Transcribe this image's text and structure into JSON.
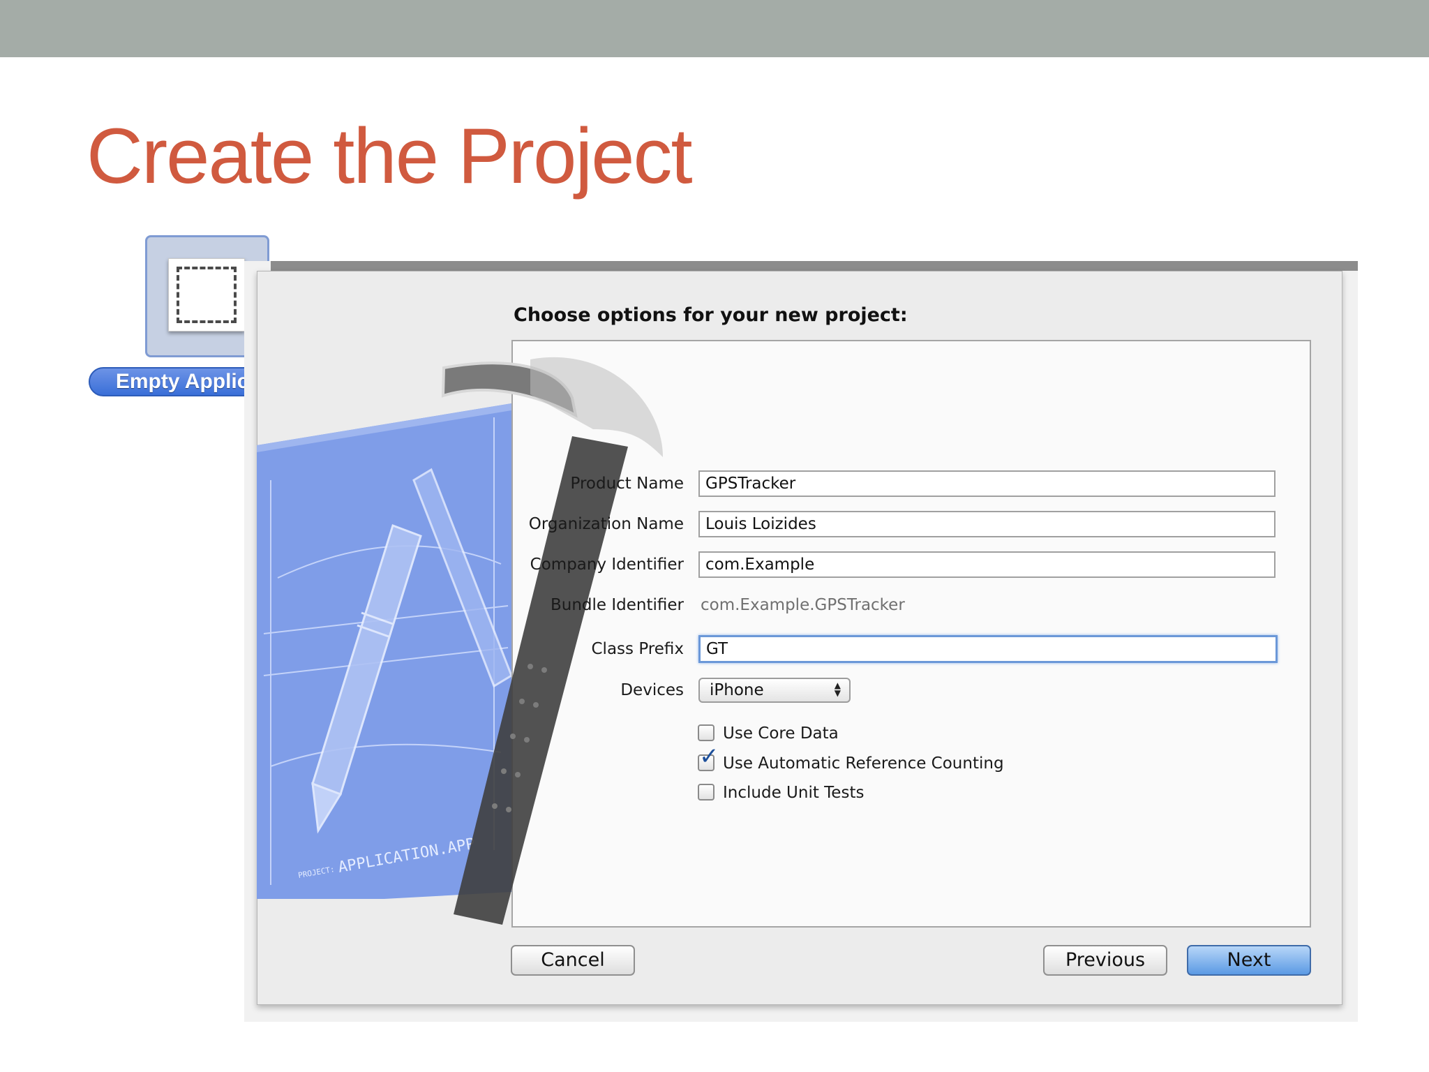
{
  "slide": {
    "title": "Create the Project"
  },
  "template": {
    "label": "Empty Application",
    "icon": "empty-window-icon"
  },
  "dialog": {
    "heading": "Choose options for your new project:",
    "fields": [
      {
        "label": "Product Name",
        "value": "GPSTracker"
      },
      {
        "label": "Organization Name",
        "value": "Louis Loizides"
      },
      {
        "label": "Company Identifier",
        "value": "com.Example"
      }
    ],
    "bundle": {
      "label": "Bundle Identifier",
      "value": "com.Example.GPSTracker"
    },
    "class_prefix": {
      "label": "Class Prefix",
      "value": "GT"
    },
    "devices": {
      "label": "Devices",
      "selected": "iPhone"
    },
    "checkboxes": [
      {
        "label": "Use Core Data",
        "checked": false
      },
      {
        "label": "Use Automatic Reference Counting",
        "checked": true
      },
      {
        "label": "Include Unit Tests",
        "checked": false
      }
    ],
    "buttons": {
      "cancel": "Cancel",
      "previous": "Previous",
      "next": "Next"
    },
    "artwork": {
      "blueprint_caption": "APPLICATION.APP",
      "blueprint_prefix": "PROJECT:"
    }
  },
  "colors": {
    "title": "#d05a3f",
    "topbar": "#a4aca7",
    "accent": "#5b9ae4",
    "blueprint": "#7f9de8"
  }
}
